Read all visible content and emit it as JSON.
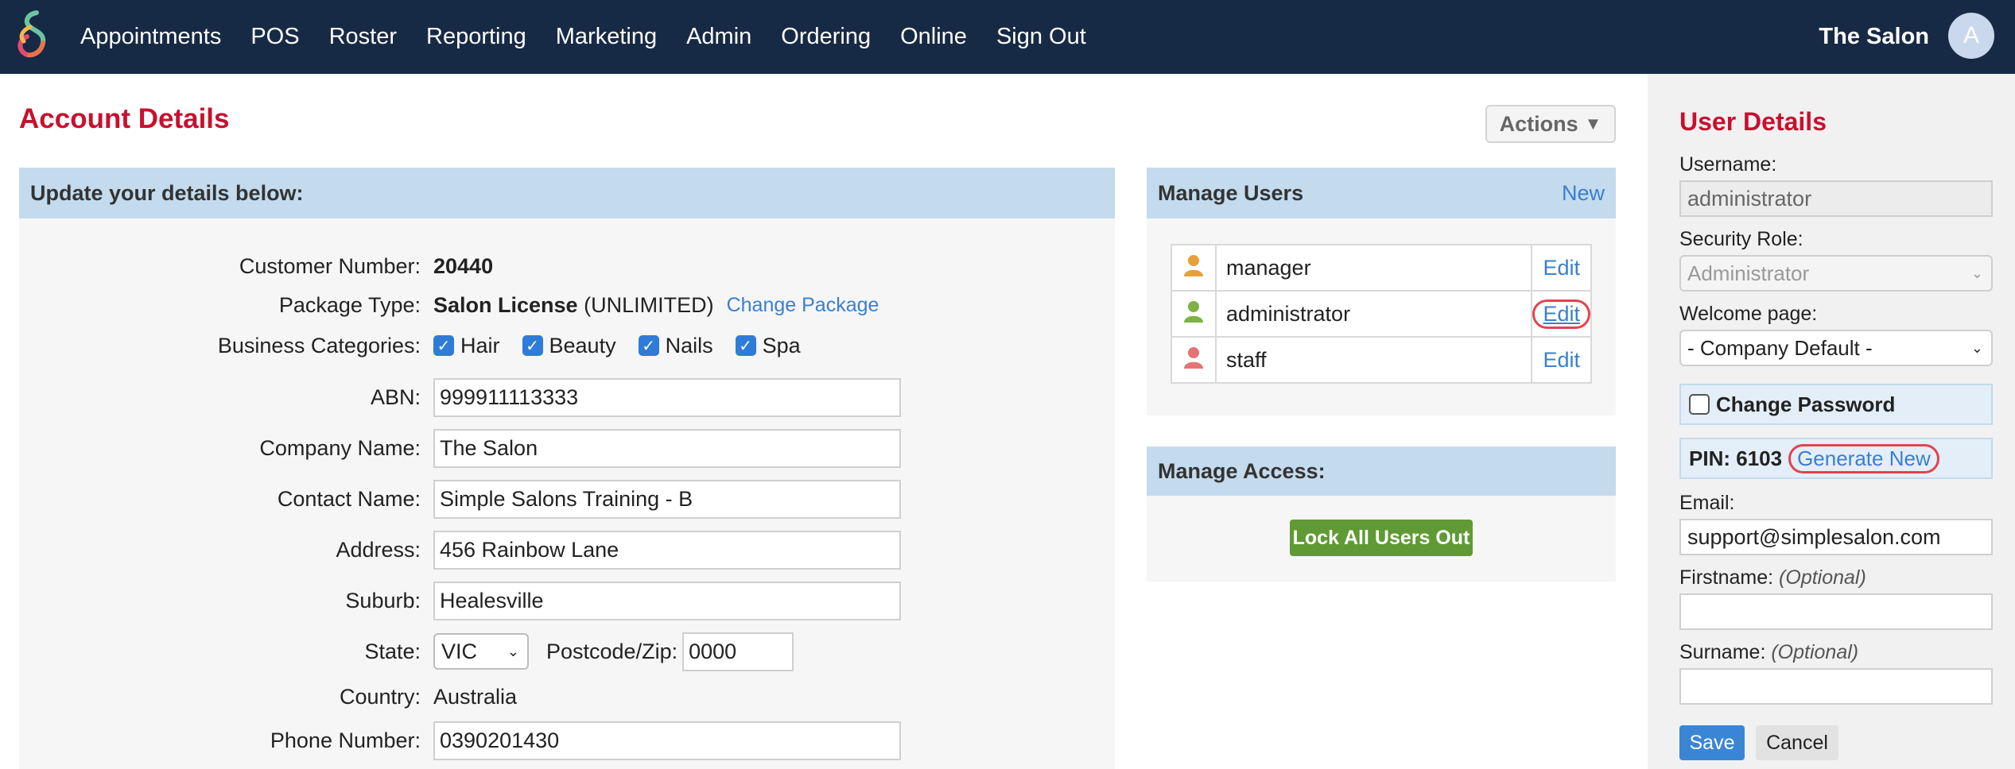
{
  "nav": {
    "items": [
      "Appointments",
      "POS",
      "Roster",
      "Reporting",
      "Marketing",
      "Admin",
      "Ordering",
      "Online",
      "Sign Out"
    ],
    "salon_name": "The Salon",
    "avatar_initial": "A"
  },
  "page": {
    "title": "Account Details",
    "actions_label": "Actions"
  },
  "account": {
    "header": "Update your details below:",
    "customer_number_label": "Customer Number:",
    "customer_number": "20440",
    "package_type_label": "Package Type:",
    "package_name": "Salon License",
    "package_limit": "(UNLIMITED)",
    "change_package_label": "Change Package",
    "business_categories_label": "Business Categories:",
    "categories": [
      {
        "label": "Hair",
        "checked": true
      },
      {
        "label": "Beauty",
        "checked": true
      },
      {
        "label": "Nails",
        "checked": true
      },
      {
        "label": "Spa",
        "checked": true
      }
    ],
    "abn_label": "ABN:",
    "abn": "999911113333",
    "company_name_label": "Company Name:",
    "company_name": "The Salon",
    "contact_name_label": "Contact Name:",
    "contact_name": "Simple Salons Training - B",
    "address_label": "Address:",
    "address": "456 Rainbow Lane",
    "suburb_label": "Suburb:",
    "suburb": "Healesville",
    "state_label": "State:",
    "state": "VIC",
    "postcode_label": "Postcode/Zip:",
    "postcode": "0000",
    "country_label": "Country:",
    "country": "Australia",
    "phone_label": "Phone Number:",
    "phone": "0390201430"
  },
  "manage_users": {
    "header": "Manage Users",
    "new_label": "New",
    "users": [
      {
        "name": "manager",
        "edit": "Edit",
        "icon_color": "#e8a03c"
      },
      {
        "name": "administrator",
        "edit": "Edit",
        "icon_color": "#7cb342"
      },
      {
        "name": "staff",
        "edit": "Edit",
        "icon_color": "#e57373"
      }
    ]
  },
  "manage_access": {
    "header": "Manage Access:",
    "lock_label": "Lock All Users Out"
  },
  "user_details": {
    "title": "User Details",
    "username_label": "Username:",
    "username": "administrator",
    "security_role_label": "Security Role:",
    "security_role": "Administrator",
    "welcome_page_label": "Welcome page:",
    "welcome_page": "- Company Default -",
    "change_password_label": "Change Password",
    "pin_label": "PIN:",
    "pin": "6103",
    "generate_new_label": "Generate New",
    "email_label": "Email:",
    "email": "support@simplesalon.com",
    "firstname_label": "Firstname:",
    "surname_label": "Surname:",
    "optional_label": "(Optional)",
    "firstname": "",
    "surname": "",
    "save_label": "Save",
    "cancel_label": "Cancel"
  },
  "colors": {
    "nav_bg": "#172a45",
    "title_red": "#c8102e",
    "panel_header": "#c3dbed",
    "link_blue": "#3a7fd0",
    "lock_green": "#5f9a35",
    "save_blue": "#3a86d4",
    "highlight_circle": "#e0444f"
  }
}
